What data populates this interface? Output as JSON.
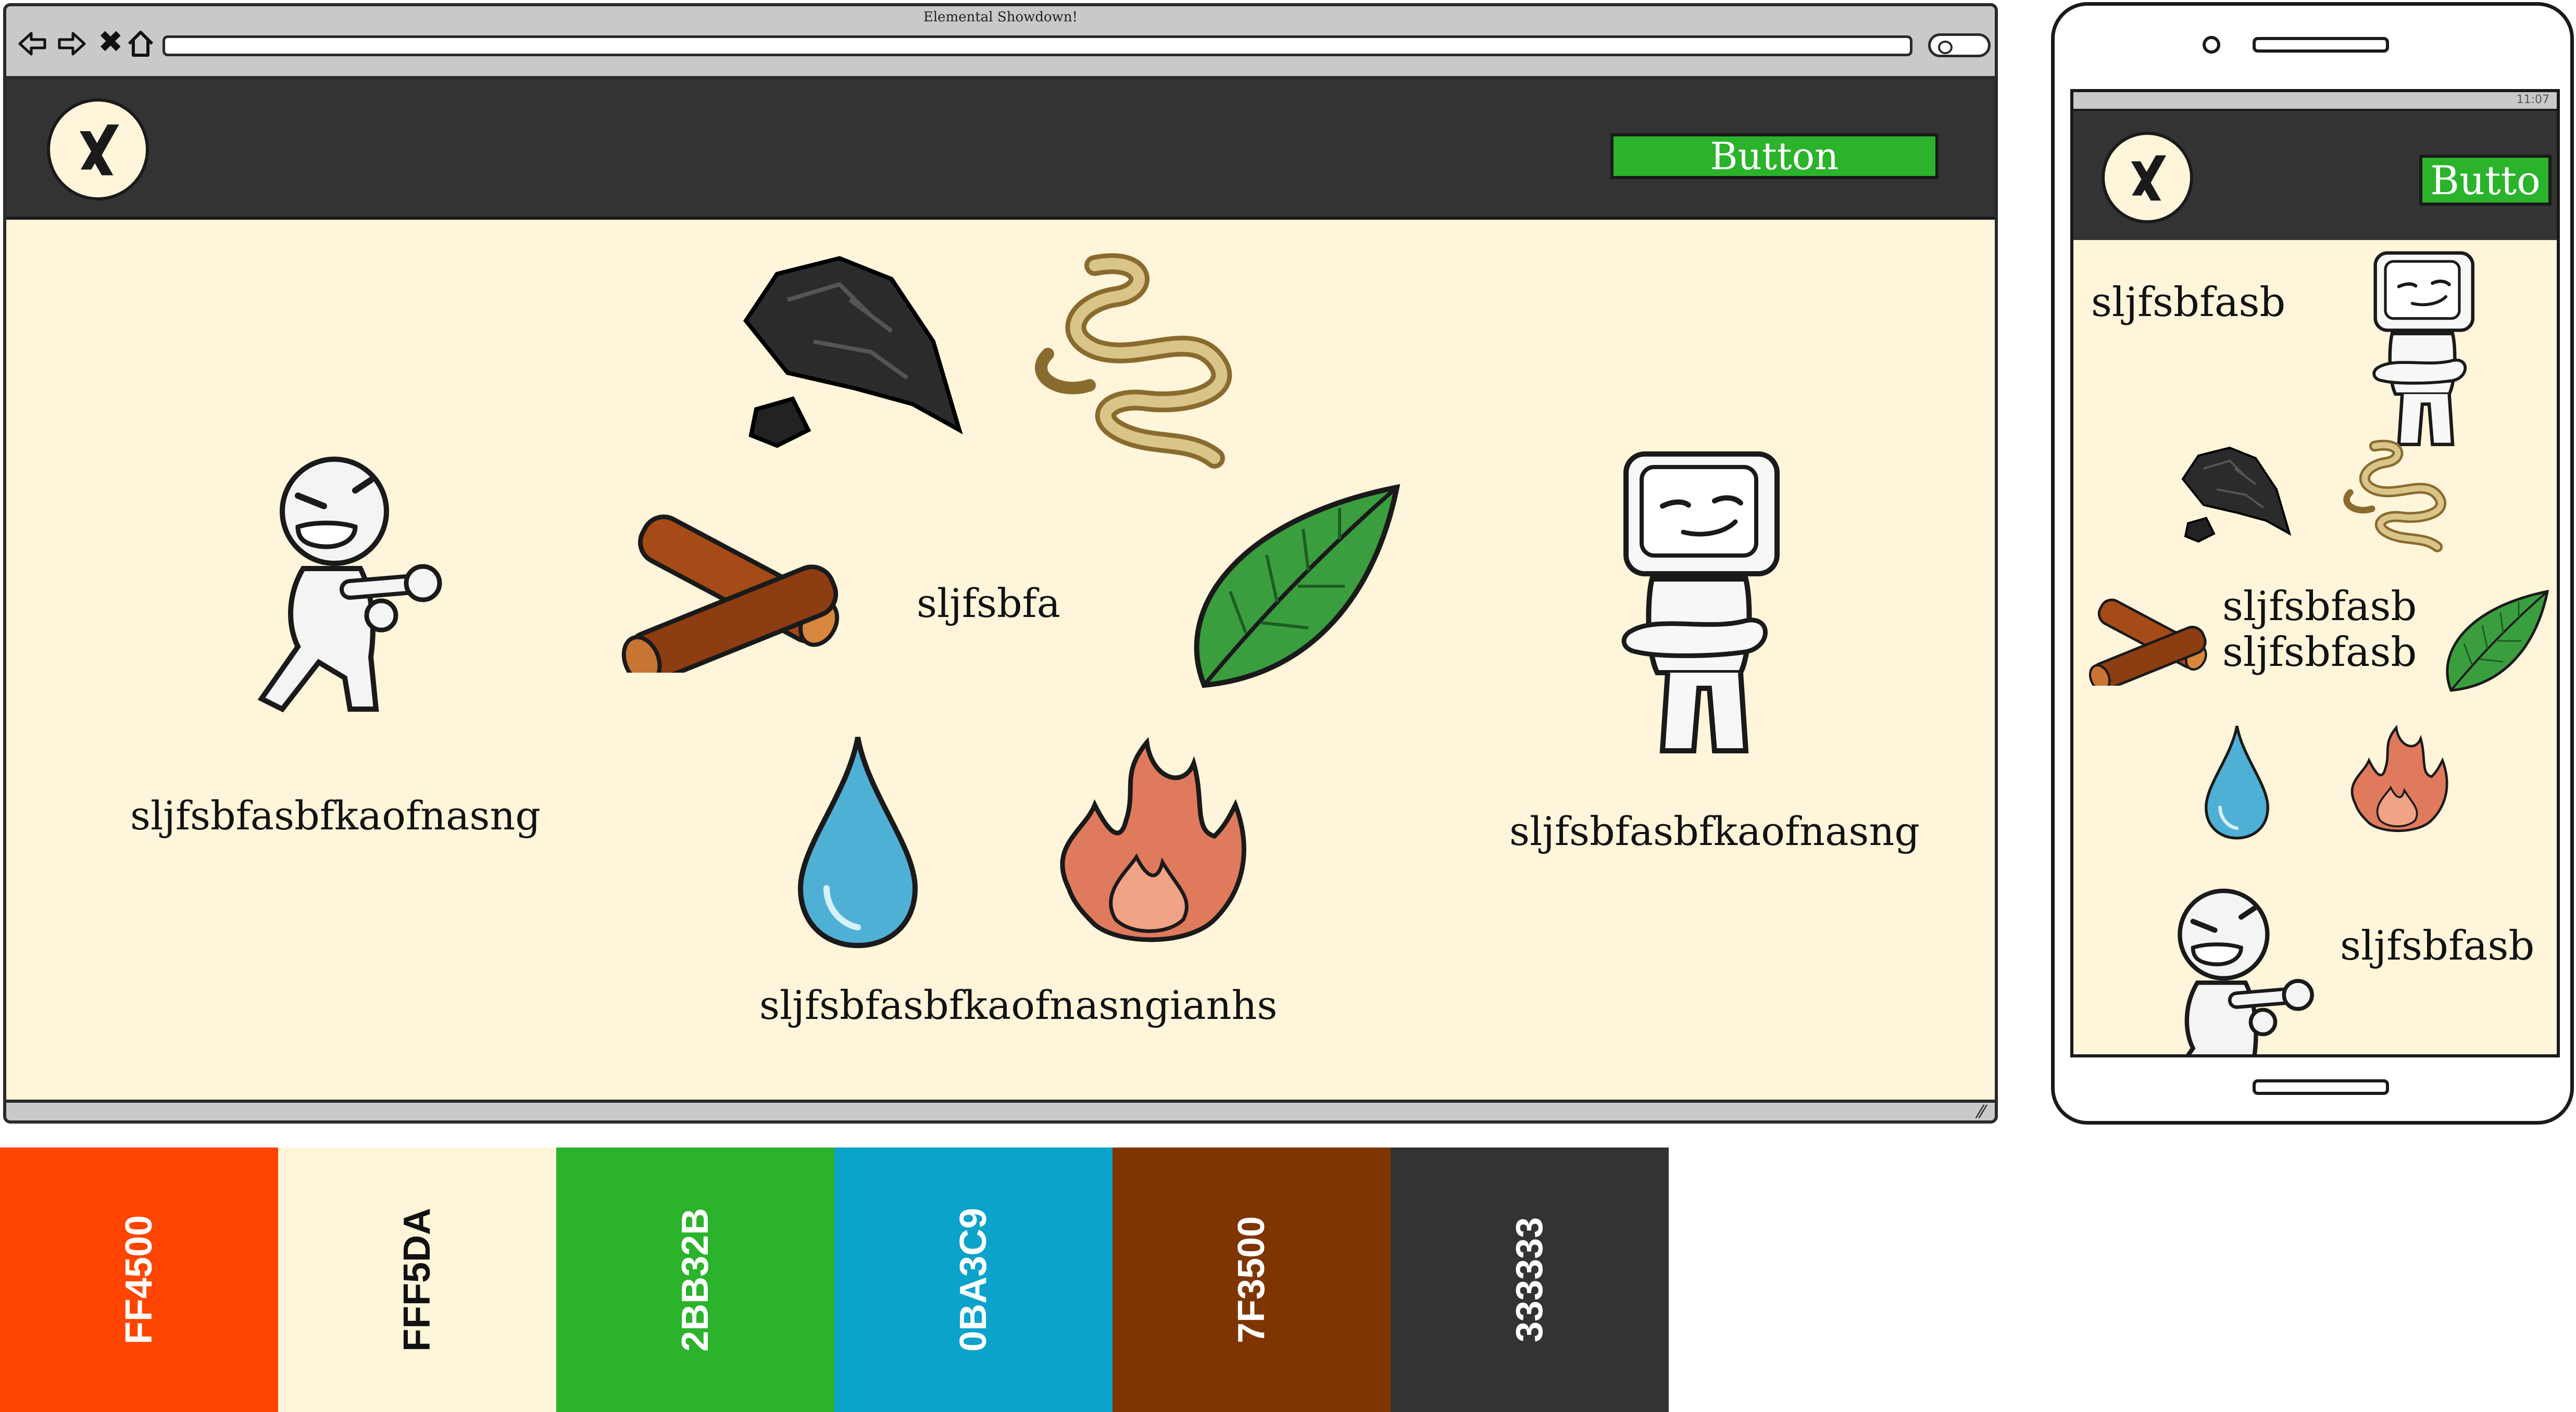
{
  "browser": {
    "window_title": "Elemental Showdown!",
    "nav": {
      "back_icon": "arrow-left-icon",
      "forward_icon": "arrow-right-icon",
      "close_glyph": "✖",
      "home_icon": "home-icon"
    }
  },
  "desktop": {
    "header": {
      "logo_icon": "xing-logo",
      "button_label": "Button"
    },
    "player_left": {
      "name": "sljfsbfasbfkaofnasng"
    },
    "player_right": {
      "name": "sljfsbfasbfkaofnasng"
    },
    "center_label": "sljfsbfa",
    "bottom_label": "sljfsbfasbfkaofnasngianhs",
    "elements": [
      "coal-icon",
      "smoke-icon",
      "wood-icon",
      "leaf-icon",
      "water-drop-icon",
      "fire-icon"
    ]
  },
  "phone": {
    "status": {
      "time": "11:07"
    },
    "header": {
      "button_label": "Butto"
    },
    "opponent_label": "sljfsbfasb",
    "center_label_1": "sljfsbfasb",
    "center_label_2": "sljfsbfasb",
    "player_label": "sljfsbfasb"
  },
  "palette": [
    {
      "hex": "FF4500",
      "color": "#FF4500",
      "text_color": "#ffffff"
    },
    {
      "hex": "FFF5DA",
      "color": "#FFF5DA",
      "text_color": "#111111"
    },
    {
      "hex": "2BB32B",
      "color": "#2BB32B",
      "text_color": "#ffffff"
    },
    {
      "hex": "0BA3C9",
      "color": "#0BA3C9",
      "text_color": "#ffffff"
    },
    {
      "hex": "7F3500",
      "color": "#7F3500",
      "text_color": "#ffffff"
    },
    {
      "hex": "333333",
      "color": "#333333",
      "text_color": "#ffffff"
    }
  ]
}
